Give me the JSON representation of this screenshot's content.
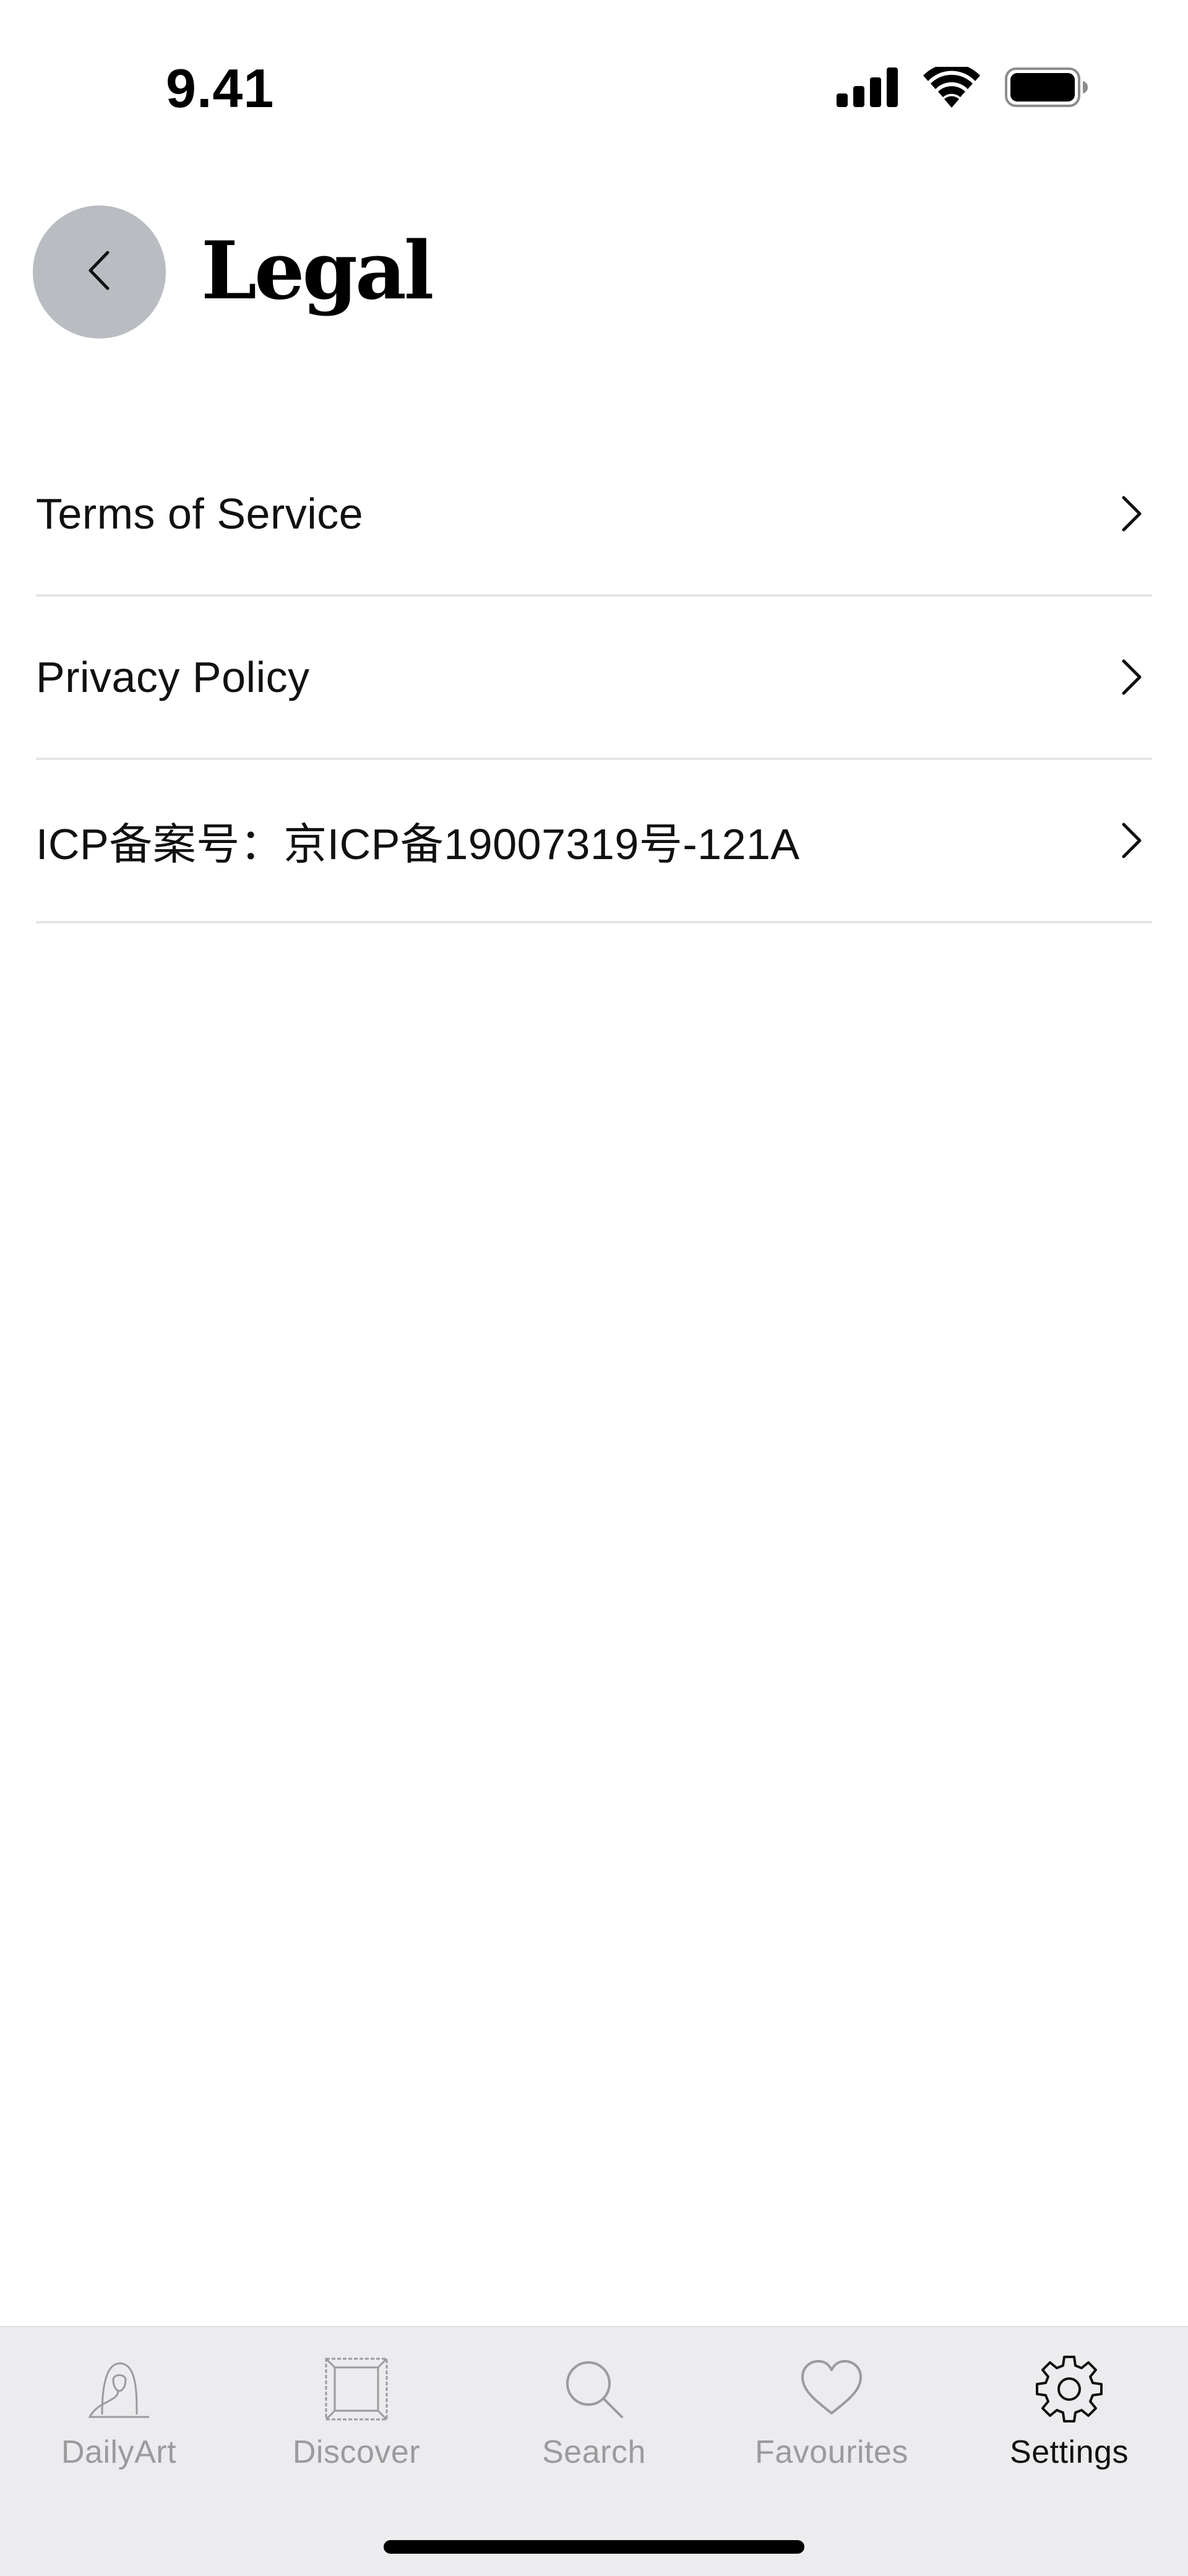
{
  "status_bar": {
    "time": "9.41",
    "icons": [
      "cellular-signal-icon",
      "wifi-icon",
      "battery-icon"
    ]
  },
  "header": {
    "back_icon": "chevron-left-icon",
    "title": "Legal"
  },
  "list": {
    "items": [
      {
        "label": "Terms of Service"
      },
      {
        "label": "Privacy Policy"
      },
      {
        "label": "ICP备案号：京ICP备19007319号-121A"
      }
    ]
  },
  "tab_bar": {
    "tabs": [
      {
        "label": "DailyArt",
        "icon": "portrait-icon",
        "active": false
      },
      {
        "label": "Discover",
        "icon": "frame-icon",
        "active": false
      },
      {
        "label": "Search",
        "icon": "search-icon",
        "active": false
      },
      {
        "label": "Favourites",
        "icon": "heart-icon",
        "active": false
      },
      {
        "label": "Settings",
        "icon": "gear-icon",
        "active": true
      }
    ]
  },
  "colors": {
    "back_button_bg": "#b9bcc1",
    "tab_bar_bg": "#ececee",
    "tab_inactive": "#9b9b9e",
    "tab_active": "#111111",
    "divider": "#e6e6e6"
  }
}
